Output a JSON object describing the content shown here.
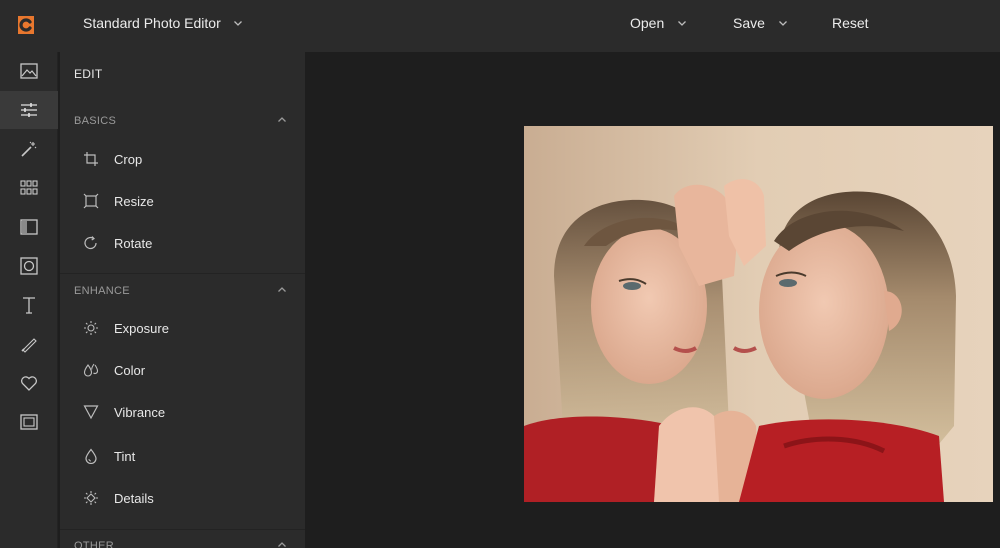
{
  "header": {
    "app_title": "Standard Photo Editor",
    "menu": [
      {
        "label": "Open"
      },
      {
        "label": "Save"
      },
      {
        "label": "Reset"
      }
    ]
  },
  "rail": {
    "items": [
      {
        "icon": "image-icon"
      },
      {
        "icon": "sliders-icon",
        "active": true
      },
      {
        "icon": "magic-wand-icon"
      },
      {
        "icon": "grid-icon"
      },
      {
        "icon": "filter-frame-icon"
      },
      {
        "icon": "vignette-icon"
      },
      {
        "icon": "text-icon"
      },
      {
        "icon": "brush-icon"
      },
      {
        "icon": "heart-icon"
      },
      {
        "icon": "frame-icon"
      }
    ]
  },
  "panel": {
    "title": "EDIT",
    "sections": [
      {
        "label": "BASICS",
        "tools": [
          {
            "label": "Crop",
            "icon": "crop-icon"
          },
          {
            "label": "Resize",
            "icon": "resize-icon"
          },
          {
            "label": "Rotate",
            "icon": "rotate-icon"
          }
        ]
      },
      {
        "label": "ENHANCE",
        "tools": [
          {
            "label": "Exposure",
            "icon": "sun-icon"
          },
          {
            "label": "Color",
            "icon": "droplets-icon"
          },
          {
            "label": "Vibrance",
            "icon": "triangle-icon"
          },
          {
            "label": "Tint",
            "icon": "drop-icon"
          },
          {
            "label": "Details",
            "icon": "details-icon"
          }
        ]
      },
      {
        "label": "OTHER",
        "tools": []
      }
    ]
  },
  "colors": {
    "brand": "#e8772e",
    "bar": "#2b2b2b",
    "canvas": "#1e1e1e",
    "active_rail": "#3a3a3a"
  }
}
